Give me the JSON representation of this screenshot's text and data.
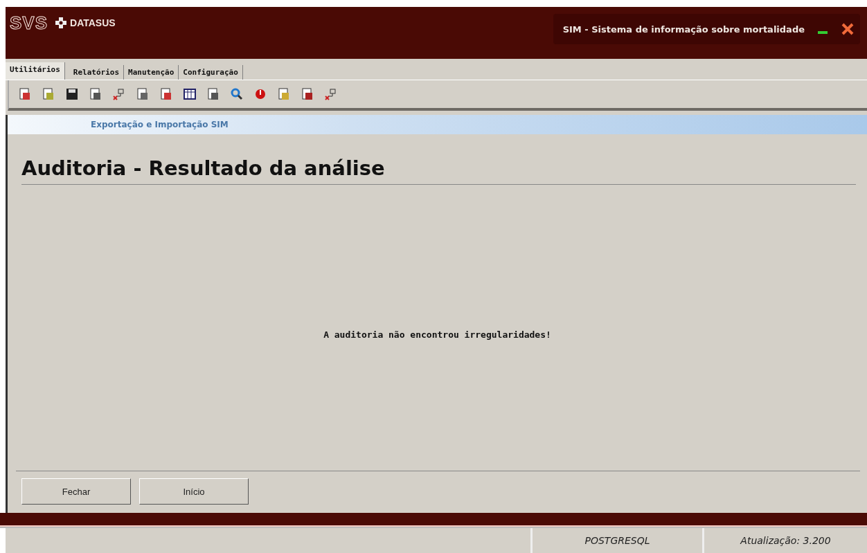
{
  "header": {
    "logo_text": "SVS",
    "brand": "DATASUS",
    "title": "SIM - Sistema de informação sobre mortalidade"
  },
  "tabs": [
    {
      "label": "Utilitários",
      "selected": true
    },
    {
      "label": "Relatórios",
      "selected": false
    },
    {
      "label": "Manutenção",
      "selected": false
    },
    {
      "label": "Configuração",
      "selected": false
    }
  ],
  "banner": "Exportação e Importação SIM",
  "heading": "Auditoria - Resultado da análise",
  "message": "A auditoria não encontrou irregularidades!",
  "buttons": [
    "Fechar",
    "Início"
  ],
  "status_bar": {
    "database": "POSTGRESQL",
    "version": "Atualização: 3.200"
  }
}
